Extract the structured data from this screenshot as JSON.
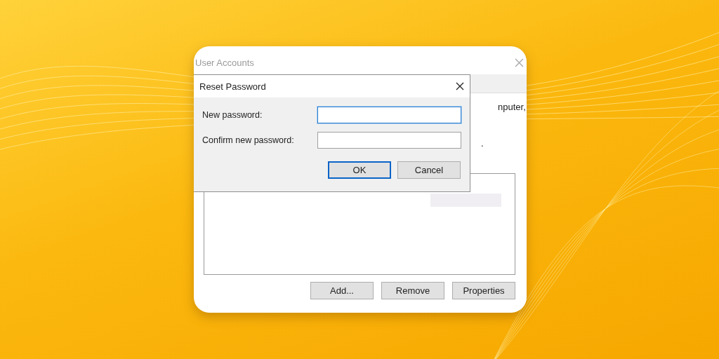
{
  "user_accounts_window": {
    "title": "User Accounts",
    "text_fragments": [
      "nputer,",
      "."
    ],
    "buttons": [
      {
        "label": "Add..."
      },
      {
        "label": "Remove"
      },
      {
        "label": "Properties"
      }
    ]
  },
  "reset_password_dialog": {
    "title": "Reset Password",
    "fields": [
      {
        "label": "New password:",
        "focused": true
      },
      {
        "label": "Confirm new password:",
        "focused": false
      }
    ],
    "buttons": [
      {
        "label": "OK",
        "default": true
      },
      {
        "label": "Cancel",
        "default": false
      }
    ]
  }
}
